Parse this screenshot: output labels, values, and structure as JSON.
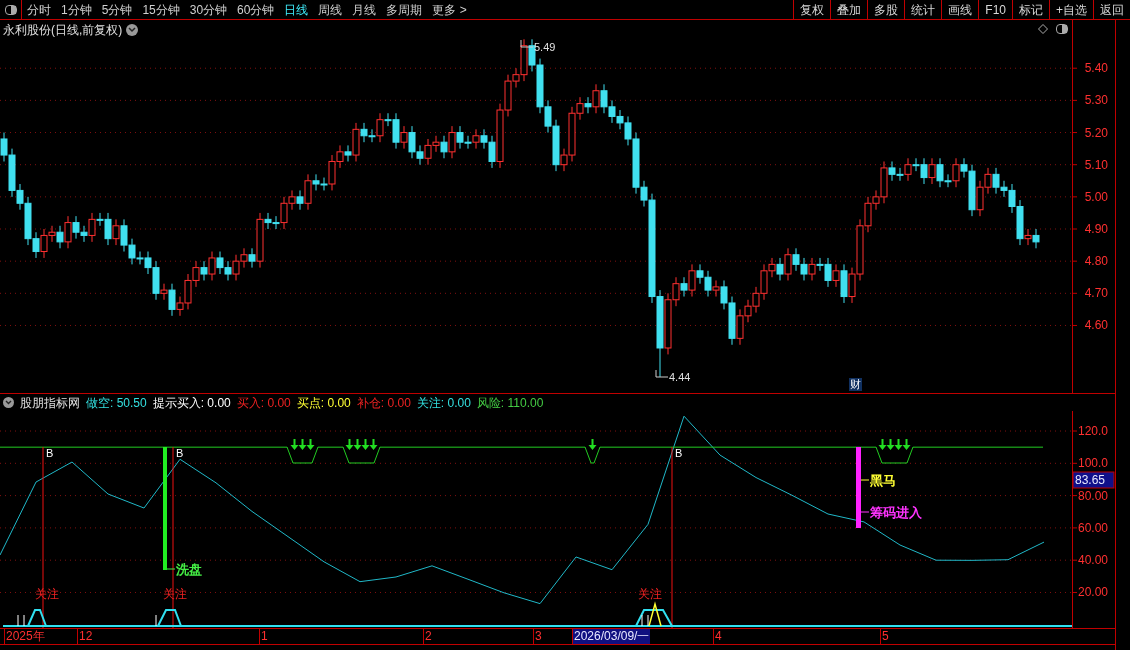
{
  "toolbar": {
    "periods": [
      {
        "label": "分时",
        "selected": false
      },
      {
        "label": "1分钟",
        "selected": false
      },
      {
        "label": "5分钟",
        "selected": false
      },
      {
        "label": "15分钟",
        "selected": false
      },
      {
        "label": "30分钟",
        "selected": false
      },
      {
        "label": "60分钟",
        "selected": false
      },
      {
        "label": "日线",
        "selected": true
      },
      {
        "label": "周线",
        "selected": false
      },
      {
        "label": "月线",
        "selected": false
      },
      {
        "label": "多周期",
        "selected": false
      },
      {
        "label": "更多 >",
        "selected": false
      }
    ],
    "buttons": [
      "复权",
      "叠加",
      "多股",
      "统计",
      "画线",
      "F10",
      "标记",
      "+自选",
      "返回"
    ]
  },
  "price_chart": {
    "title": "永利股份(日线,前复权)",
    "high_label": "5.49",
    "low_label": "4.44",
    "news_badge": "财",
    "chart_data": {
      "type": "candlestick",
      "grid": true,
      "ylim": [
        4.39,
        5.55
      ],
      "yticks": [
        {
          "value": 5.4,
          "label": "5.40"
        },
        {
          "value": 5.3,
          "label": "5.30"
        },
        {
          "value": 5.2,
          "label": "5.20"
        },
        {
          "value": 5.1,
          "label": "5.10"
        },
        {
          "value": 5.0,
          "label": "5.00"
        },
        {
          "value": 4.9,
          "label": "4.90"
        },
        {
          "value": 4.8,
          "label": "4.80"
        },
        {
          "value": 4.7,
          "label": "4.70"
        },
        {
          "value": 4.6,
          "label": "4.60"
        }
      ],
      "ohlc": [
        [
          5.18,
          5.2,
          5.11,
          5.13
        ],
        [
          5.13,
          5.15,
          5.0,
          5.02
        ],
        [
          5.02,
          5.04,
          4.96,
          4.98
        ],
        [
          4.98,
          5.0,
          4.85,
          4.87
        ],
        [
          4.87,
          4.89,
          4.81,
          4.83
        ],
        [
          4.83,
          4.9,
          4.81,
          4.88
        ],
        [
          4.88,
          4.91,
          4.86,
          4.89
        ],
        [
          4.89,
          4.91,
          4.84,
          4.86
        ],
        [
          4.86,
          4.94,
          4.84,
          4.92
        ],
        [
          4.92,
          4.94,
          4.87,
          4.89
        ],
        [
          4.89,
          4.91,
          4.86,
          4.88
        ],
        [
          4.88,
          4.95,
          4.86,
          4.93
        ],
        [
          4.93,
          4.95,
          4.91,
          4.93
        ],
        [
          4.93,
          4.95,
          4.85,
          4.87
        ],
        [
          4.87,
          4.93,
          4.85,
          4.91
        ],
        [
          4.91,
          4.93,
          4.83,
          4.85
        ],
        [
          4.85,
          4.87,
          4.79,
          4.81
        ],
        [
          4.81,
          4.83,
          4.79,
          4.81
        ],
        [
          4.81,
          4.83,
          4.76,
          4.78
        ],
        [
          4.78,
          4.8,
          4.68,
          4.7
        ],
        [
          4.7,
          4.73,
          4.68,
          4.71
        ],
        [
          4.71,
          4.73,
          4.63,
          4.65
        ],
        [
          4.65,
          4.69,
          4.63,
          4.67
        ],
        [
          4.67,
          4.76,
          4.65,
          4.74
        ],
        [
          4.74,
          4.8,
          4.72,
          4.78
        ],
        [
          4.78,
          4.8,
          4.74,
          4.76
        ],
        [
          4.76,
          4.83,
          4.74,
          4.81
        ],
        [
          4.81,
          4.83,
          4.76,
          4.78
        ],
        [
          4.78,
          4.8,
          4.74,
          4.76
        ],
        [
          4.76,
          4.82,
          4.74,
          4.8
        ],
        [
          4.8,
          4.84,
          4.78,
          4.82
        ],
        [
          4.82,
          4.84,
          4.78,
          4.8
        ],
        [
          4.8,
          4.95,
          4.78,
          4.93
        ],
        [
          4.93,
          4.95,
          4.9,
          4.92
        ],
        [
          4.92,
          4.94,
          4.9,
          4.92
        ],
        [
          4.92,
          5.0,
          4.9,
          4.98
        ],
        [
          4.98,
          5.02,
          4.96,
          5.0
        ],
        [
          5.0,
          5.02,
          4.96,
          4.98
        ],
        [
          4.98,
          5.07,
          4.96,
          5.05
        ],
        [
          5.05,
          5.07,
          5.02,
          5.04
        ],
        [
          5.04,
          5.06,
          5.02,
          5.04
        ],
        [
          5.04,
          5.13,
          5.02,
          5.11
        ],
        [
          5.11,
          5.16,
          5.09,
          5.14
        ],
        [
          5.14,
          5.16,
          5.11,
          5.13
        ],
        [
          5.13,
          5.23,
          5.11,
          5.21
        ],
        [
          5.21,
          5.23,
          5.17,
          5.19
        ],
        [
          5.19,
          5.21,
          5.17,
          5.19
        ],
        [
          5.19,
          5.26,
          5.17,
          5.24
        ],
        [
          5.24,
          5.26,
          5.22,
          5.24
        ],
        [
          5.24,
          5.26,
          5.15,
          5.17
        ],
        [
          5.17,
          5.22,
          5.15,
          5.2
        ],
        [
          5.2,
          5.22,
          5.12,
          5.14
        ],
        [
          5.14,
          5.16,
          5.1,
          5.12
        ],
        [
          5.12,
          5.18,
          5.1,
          5.16
        ],
        [
          5.16,
          5.19,
          5.14,
          5.17
        ],
        [
          5.17,
          5.19,
          5.12,
          5.14
        ],
        [
          5.14,
          5.22,
          5.12,
          5.2
        ],
        [
          5.2,
          5.22,
          5.15,
          5.17
        ],
        [
          5.17,
          5.19,
          5.15,
          5.17
        ],
        [
          5.17,
          5.21,
          5.15,
          5.19
        ],
        [
          5.19,
          5.21,
          5.15,
          5.17
        ],
        [
          5.17,
          5.19,
          5.09,
          5.11
        ],
        [
          5.11,
          5.29,
          5.09,
          5.27
        ],
        [
          5.27,
          5.38,
          5.25,
          5.36
        ],
        [
          5.36,
          5.4,
          5.34,
          5.38
        ],
        [
          5.38,
          5.49,
          5.36,
          5.47
        ],
        [
          5.47,
          5.49,
          5.39,
          5.41
        ],
        [
          5.41,
          5.43,
          5.26,
          5.28
        ],
        [
          5.28,
          5.3,
          5.2,
          5.22
        ],
        [
          5.22,
          5.24,
          5.08,
          5.1
        ],
        [
          5.1,
          5.15,
          5.08,
          5.13
        ],
        [
          5.13,
          5.28,
          5.11,
          5.26
        ],
        [
          5.26,
          5.31,
          5.24,
          5.29
        ],
        [
          5.29,
          5.31,
          5.26,
          5.28
        ],
        [
          5.28,
          5.35,
          5.26,
          5.33
        ],
        [
          5.33,
          5.35,
          5.26,
          5.28
        ],
        [
          5.28,
          5.3,
          5.23,
          5.25
        ],
        [
          5.25,
          5.27,
          5.21,
          5.23
        ],
        [
          5.23,
          5.25,
          5.16,
          5.18
        ],
        [
          5.18,
          5.2,
          5.01,
          5.03
        ],
        [
          5.03,
          5.05,
          4.97,
          4.99
        ],
        [
          4.99,
          5.01,
          4.67,
          4.69
        ],
        [
          4.69,
          4.71,
          4.44,
          4.53
        ],
        [
          4.53,
          4.7,
          4.51,
          4.68
        ],
        [
          4.68,
          4.75,
          4.66,
          4.73
        ],
        [
          4.73,
          4.75,
          4.69,
          4.71
        ],
        [
          4.71,
          4.79,
          4.69,
          4.77
        ],
        [
          4.77,
          4.79,
          4.73,
          4.75
        ],
        [
          4.75,
          4.77,
          4.69,
          4.71
        ],
        [
          4.71,
          4.74,
          4.69,
          4.72
        ],
        [
          4.72,
          4.74,
          4.65,
          4.67
        ],
        [
          4.67,
          4.69,
          4.54,
          4.56
        ],
        [
          4.56,
          4.65,
          4.54,
          4.63
        ],
        [
          4.63,
          4.68,
          4.61,
          4.66
        ],
        [
          4.66,
          4.72,
          4.64,
          4.7
        ],
        [
          4.7,
          4.79,
          4.68,
          4.77
        ],
        [
          4.77,
          4.81,
          4.75,
          4.79
        ],
        [
          4.79,
          4.81,
          4.74,
          4.76
        ],
        [
          4.76,
          4.84,
          4.74,
          4.82
        ],
        [
          4.82,
          4.84,
          4.77,
          4.79
        ],
        [
          4.79,
          4.81,
          4.74,
          4.76
        ],
        [
          4.76,
          4.81,
          4.74,
          4.79
        ],
        [
          4.79,
          4.81,
          4.77,
          4.79
        ],
        [
          4.79,
          4.81,
          4.72,
          4.74
        ],
        [
          4.74,
          4.79,
          4.72,
          4.77
        ],
        [
          4.77,
          4.79,
          4.67,
          4.69
        ],
        [
          4.69,
          4.78,
          4.67,
          4.76
        ],
        [
          4.76,
          4.93,
          4.74,
          4.91
        ],
        [
          4.91,
          5.0,
          4.89,
          4.98
        ],
        [
          4.98,
          5.02,
          4.96,
          5.0
        ],
        [
          5.0,
          5.11,
          4.98,
          5.09
        ],
        [
          5.09,
          5.11,
          5.05,
          5.07
        ],
        [
          5.07,
          5.09,
          5.05,
          5.07
        ],
        [
          5.07,
          5.12,
          5.05,
          5.1
        ],
        [
          5.1,
          5.12,
          5.08,
          5.1
        ],
        [
          5.1,
          5.12,
          5.04,
          5.06
        ],
        [
          5.06,
          5.12,
          5.04,
          5.1
        ],
        [
          5.1,
          5.12,
          5.03,
          5.05
        ],
        [
          5.05,
          5.07,
          5.03,
          5.05
        ],
        [
          5.05,
          5.12,
          5.03,
          5.1
        ],
        [
          5.1,
          5.12,
          5.06,
          5.08
        ],
        [
          5.08,
          5.1,
          4.94,
          4.96
        ],
        [
          4.96,
          5.05,
          4.94,
          5.03
        ],
        [
          5.03,
          5.09,
          5.01,
          5.07
        ],
        [
          5.07,
          5.09,
          5.01,
          5.03
        ],
        [
          5.03,
          5.05,
          5.0,
          5.02
        ],
        [
          5.02,
          5.04,
          4.95,
          4.97
        ],
        [
          4.97,
          4.99,
          4.85,
          4.87
        ],
        [
          4.87,
          4.9,
          4.85,
          4.88
        ],
        [
          4.88,
          4.9,
          4.84,
          4.86
        ]
      ]
    }
  },
  "indicator": {
    "name": "股朋指标网",
    "values": [
      {
        "text": "做空: 50.50",
        "color": "#33e0e0"
      },
      {
        "text": "提示买入: 0.00",
        "color": "#ffffff"
      },
      {
        "text": "买入: 0.00",
        "color": "#ee2222"
      },
      {
        "text": "买点: 0.00",
        "color": "#ffff33"
      },
      {
        "text": "补仓: 0.00",
        "color": "#ee2222"
      },
      {
        "text": "关注: 0.00",
        "color": "#33e0e0"
      },
      {
        "text": "风险: 110.00",
        "color": "#44cc44"
      }
    ],
    "chart_data": {
      "type": "line",
      "grid": true,
      "ylim": [
        -2,
        132.4
      ],
      "yticks": [
        {
          "value": 120,
          "label": "120.0"
        },
        {
          "value": 100,
          "label": "100.0"
        },
        {
          "value": 80,
          "label": "80.00"
        },
        {
          "value": 60,
          "label": "60.00"
        },
        {
          "value": 40,
          "label": "40.00"
        },
        {
          "value": 20,
          "label": "20.00"
        }
      ],
      "series": [
        {
          "color": "#20b8c8",
          "values": [
            43.2,
            88.4,
            100.8,
            81.0,
            72.3,
            102.5,
            87.9,
            70.2,
            54.6,
            39.0,
            26.7,
            29.6,
            36.5,
            28.2,
            19.8,
            13.1,
            42.0,
            34.1,
            62.2,
            129.2,
            105.1,
            91.2,
            80.2,
            68.6,
            63.7,
            49.4,
            40.0,
            39.9,
            40.3,
            51.2
          ]
        },
        {
          "color": "#22cc22",
          "values": [
            110,
            110,
            110,
            110,
            110,
            110,
            110,
            110,
            null,
            110,
            null,
            110,
            110,
            110,
            110,
            110,
            110,
            110,
            110,
            110,
            110,
            110,
            110,
            110,
            110,
            null,
            110,
            110,
            110,
            110
          ]
        }
      ]
    },
    "current_value": "83.65",
    "buy_marks": [
      "B",
      "B",
      "B"
    ],
    "labels": [
      {
        "text": "洗盘",
        "color": "#44ee44"
      },
      {
        "text": "黑马",
        "color": "#ffff33"
      },
      {
        "text": "筹码进入",
        "color": "#ff33ff"
      }
    ],
    "watch_marks": [
      "关注",
      "关注",
      "关注"
    ]
  },
  "date_axis": [
    {
      "label": "2025年",
      "selected": false
    },
    {
      "label": "12",
      "selected": false
    },
    {
      "label": "1",
      "selected": false
    },
    {
      "label": "2",
      "selected": false
    },
    {
      "label": "3",
      "selected": false
    },
    {
      "label": "2026/03/09/一",
      "selected": true
    },
    {
      "label": "4",
      "selected": false
    },
    {
      "label": "5",
      "selected": false
    }
  ]
}
